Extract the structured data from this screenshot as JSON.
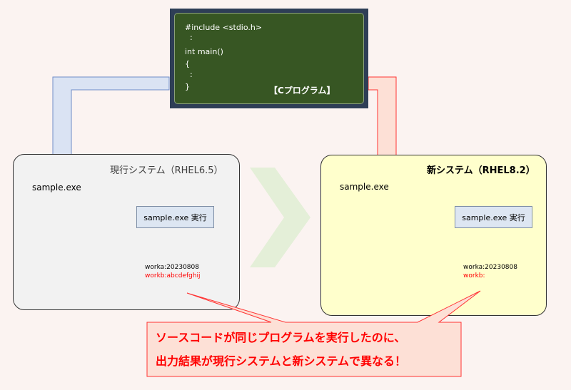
{
  "code": {
    "lines": [
      "#include <stdio.h>",
      "  :",
      "int main()",
      "{",
      "  :",
      "}"
    ],
    "title": "【Cプログラム】"
  },
  "current": {
    "title": "現行システム（RHEL6.5）",
    "file_label": "sample.exe",
    "exec_label": "sample.exe 実行",
    "worka": "worka:20230808",
    "workb": "workb:abcdefghij"
  },
  "new": {
    "title": "新システム（RHEL8.2）",
    "file_label": "sample.exe",
    "exec_label": "sample.exe 実行",
    "worka": "worka:20230808",
    "workb": "workb:"
  },
  "callout": {
    "line1": "ソースコードが同じプログラムを実行したのに、",
    "line2": "出力結果が現行システムと新システムで異なる！"
  },
  "colors": {
    "code_border": "#2e3e56",
    "code_bg": "#375623",
    "blue_arrow_fill": "#dae3f3",
    "blue_arrow_stroke": "#6f8dc8",
    "red_arrow_fill": "#fde0d6",
    "red_arrow_stroke": "#ff3333",
    "chevron": "#e4efd8",
    "current_panel_bg": "#f2f2f2",
    "new_panel_bg": "#ffffcc",
    "callout_bg": "#fde0d6",
    "callout_stroke": "#ff3333",
    "callout_text": "#ff0000",
    "workb_text": "#ff0000",
    "disk_dark": "#7f7f7f",
    "disk_light": "#ffffff"
  }
}
